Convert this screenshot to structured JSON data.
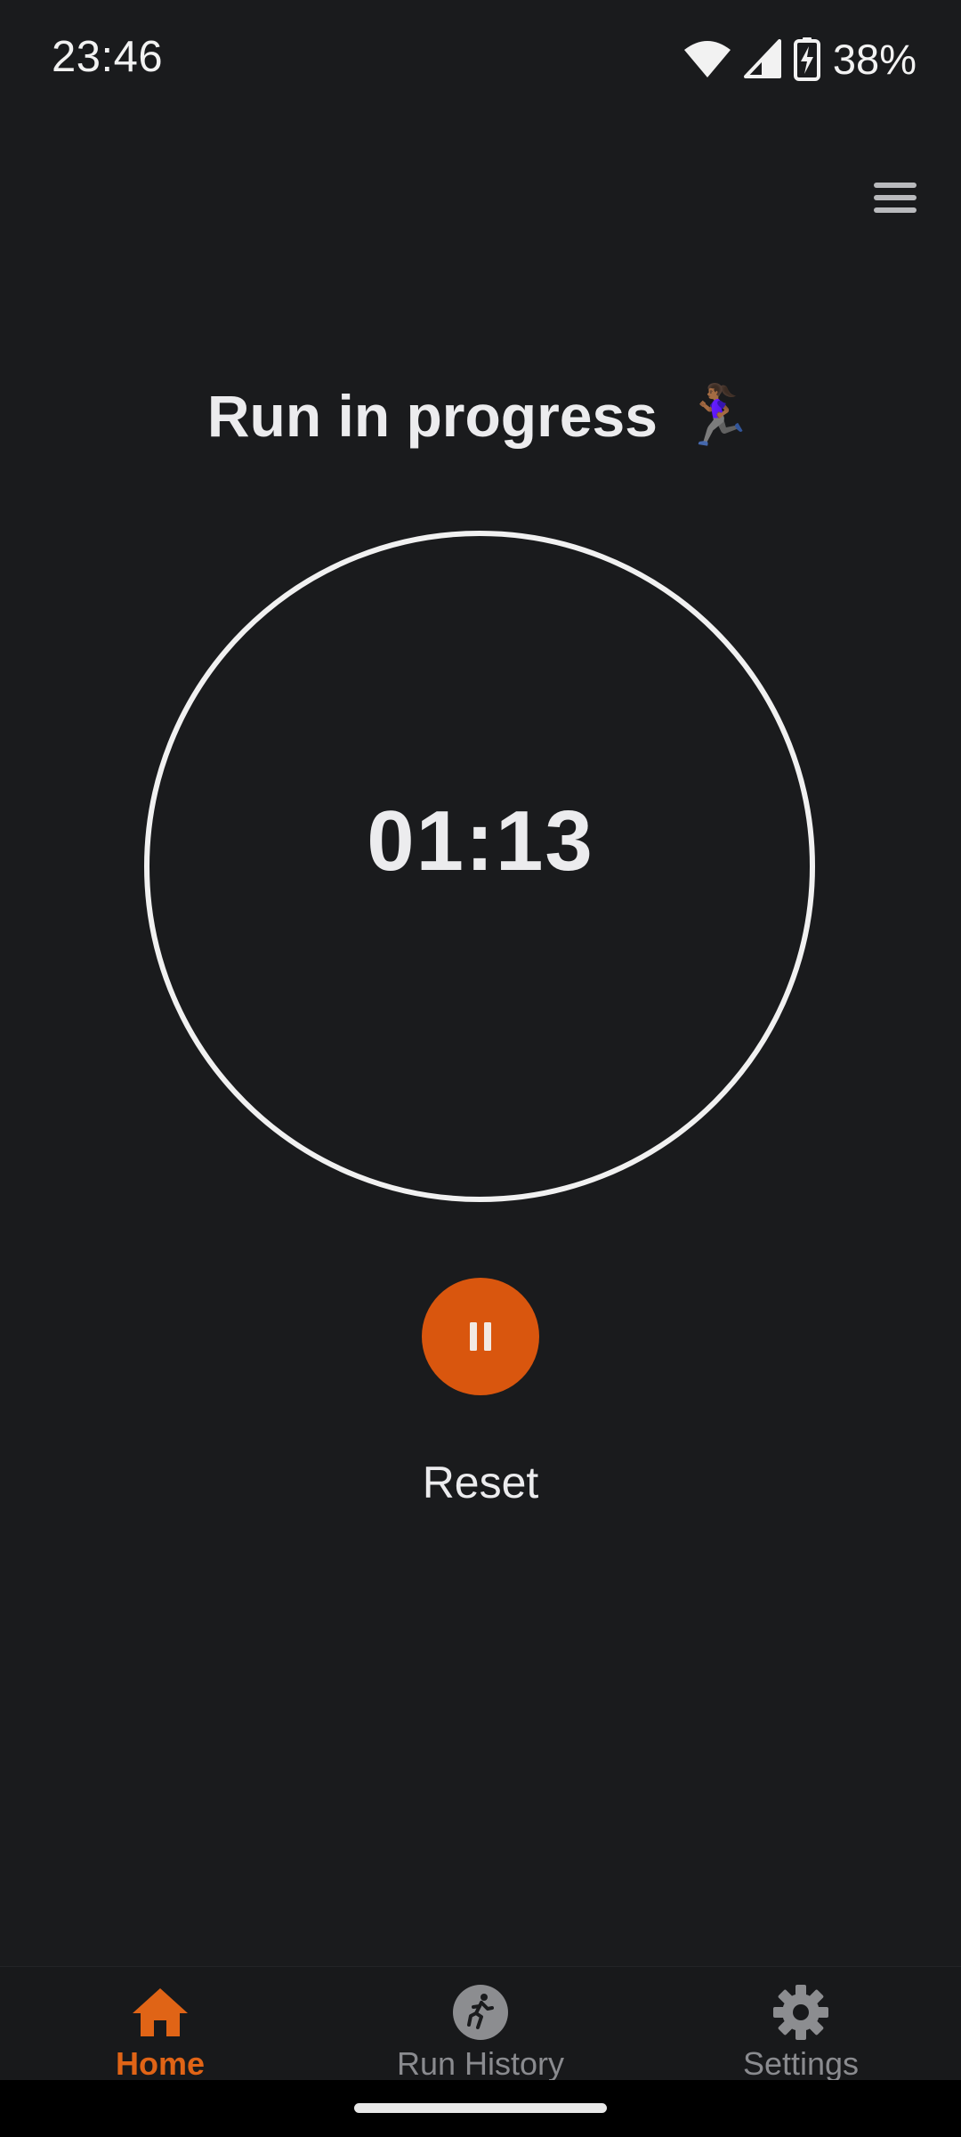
{
  "status_bar": {
    "time": "23:46",
    "battery_percent": "38%",
    "icons": [
      "wifi-icon",
      "cellular-signal-icon",
      "battery-charging-icon"
    ]
  },
  "header": {
    "menu_icon": "hamburger-menu-icon"
  },
  "main": {
    "title": "Run in progress",
    "title_emoji": "🏃🏾‍♀️",
    "timer": "01:13",
    "pause_icon": "pause-icon",
    "reset_label": "Reset"
  },
  "bottom_nav": {
    "items": [
      {
        "label": "Home",
        "icon": "home-icon",
        "active": true
      },
      {
        "label": "Run History",
        "icon": "runner-icon",
        "active": false
      },
      {
        "label": "Settings",
        "icon": "gear-icon",
        "active": false
      }
    ]
  },
  "colors": {
    "background": "#1a1b1d",
    "accent": "#d9560e",
    "text": "#ececee",
    "inactive": "#8a8b8f"
  }
}
